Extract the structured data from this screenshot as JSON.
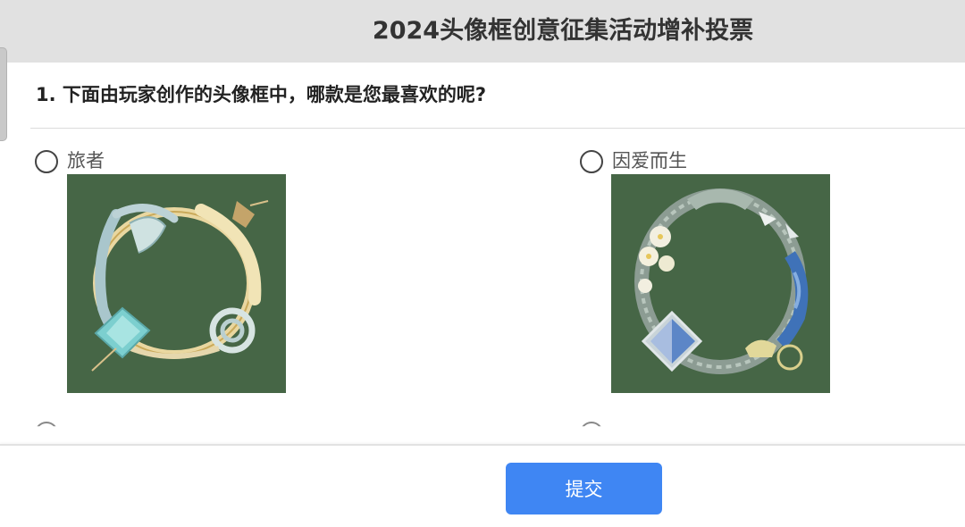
{
  "header": {
    "title": "2024头像框创意征集活动增补投票"
  },
  "question": {
    "text": "1. 下面由玩家创作的头像框中，哪款是您最喜欢的呢?"
  },
  "options": [
    {
      "label": "旅者",
      "image_icon": "avatar-frame-traveler"
    },
    {
      "label": "因爱而生",
      "image_icon": "avatar-frame-born-of-love"
    }
  ],
  "footer": {
    "submit_label": "提交"
  },
  "colors": {
    "header_bg": "#e1e1e1",
    "thumb_bg": "#466646",
    "submit_bg": "#3f86f3"
  }
}
